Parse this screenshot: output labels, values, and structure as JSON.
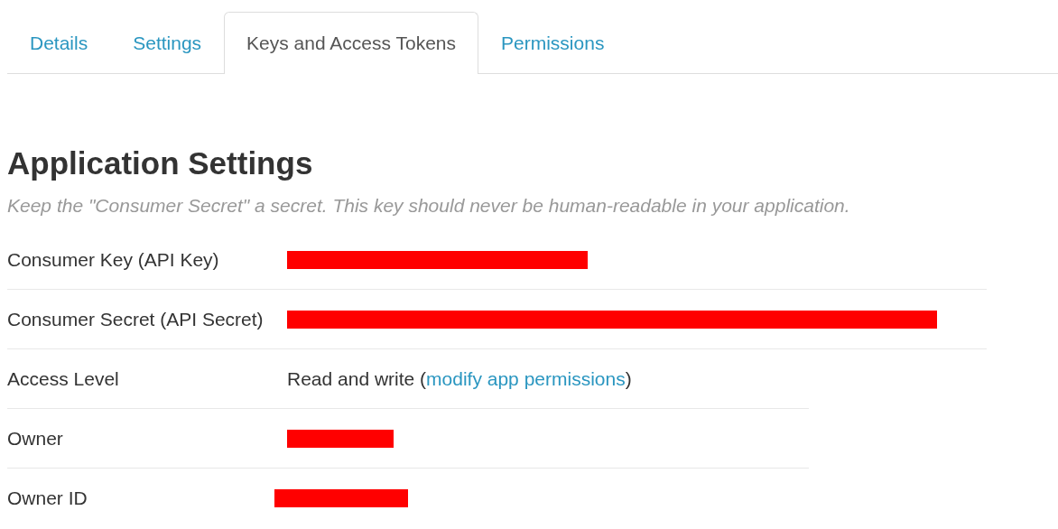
{
  "tabs": [
    {
      "label": "Details",
      "selected": false
    },
    {
      "label": "Settings",
      "selected": false
    },
    {
      "label": "Keys and Access Tokens",
      "selected": true
    },
    {
      "label": "Permissions",
      "selected": false
    }
  ],
  "heading": "Application Settings",
  "note": "Keep the \"Consumer Secret\" a secret. This key should never be human-readable in your application.",
  "rows": [
    {
      "label": "Consumer Key (API Key)",
      "kind": "redacted"
    },
    {
      "label": "Consumer Secret (API Secret)",
      "kind": "redacted"
    },
    {
      "label": "Access Level",
      "kind": "text",
      "value": "Read and write (",
      "link": "modify app permissions",
      "after": ")"
    },
    {
      "label": "Owner",
      "kind": "redacted"
    },
    {
      "label": "Owner ID",
      "kind": "redacted"
    }
  ]
}
